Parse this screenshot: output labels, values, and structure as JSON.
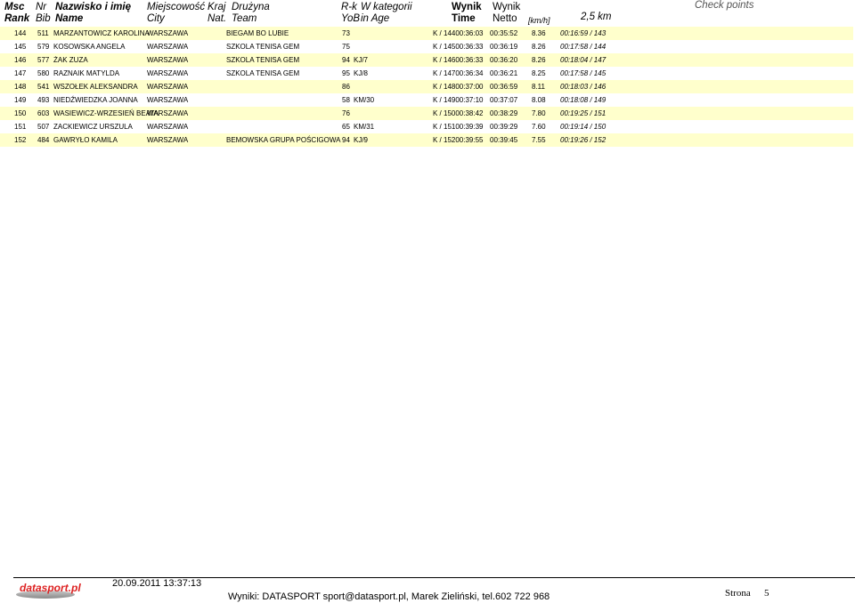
{
  "header": {
    "msc": "Msc",
    "rank": "Rank",
    "nr": "Nr",
    "bib": "Bib",
    "nazwisko": "Nazwisko i imię",
    "name": "Name",
    "miejscowosc": "Miejscowość",
    "city": "City",
    "kraj": "Kraj",
    "nat": "Nat.",
    "druzyna": "Drużyna",
    "team": "Team",
    "rk": "R-k",
    "yob": "YoB",
    "wkategorii": "W kategorii",
    "inage": "in Age",
    "wynik_bold": "Wynik",
    "time": "Time",
    "wynik": "Wynik",
    "netto": "Netto",
    "kmh": "[km/h]",
    "split": "2,5 km",
    "checkpoints": "Check points"
  },
  "rows": [
    {
      "rank": "144",
      "bib": "511",
      "name": "MARZANTOWICZ KAROLINA",
      "city": "WARSZAWA",
      "team": "BIEGAM BO LUBIE",
      "yob": "73",
      "age": "",
      "time": "K / 14400:36:03",
      "netto": "00:35:52",
      "kmh": "8.36",
      "split": "00:16:59 / 143"
    },
    {
      "rank": "145",
      "bib": "579",
      "name": "KOSOWSKA ANGELA",
      "city": "WARSZAWA",
      "team": "SZKOLA TENISA GEM",
      "yob": "75",
      "age": "",
      "time": "K / 14500:36:33",
      "netto": "00:36:19",
      "kmh": "8.26",
      "split": "00:17:58 / 144"
    },
    {
      "rank": "146",
      "bib": "577",
      "name": "ŻAK ZUZA",
      "city": "WARSZAWA",
      "team": "SZKOLA TENISA GEM",
      "yob": "94",
      "age": "KJ/7",
      "time": "K / 14600:36:33",
      "netto": "00:36:20",
      "kmh": "8.26",
      "split": "00:18:04 / 147"
    },
    {
      "rank": "147",
      "bib": "580",
      "name": "RAZNAIK MATYLDA",
      "city": "WARSZAWA",
      "team": "SZKOLA TENISA GEM",
      "yob": "95",
      "age": "KJ/8",
      "time": "K / 14700:36:34",
      "netto": "00:36:21",
      "kmh": "8.25",
      "split": "00:17:58 / 145"
    },
    {
      "rank": "148",
      "bib": "541",
      "name": "WSZOŁEK ALEKSANDRA",
      "city": "WARSZAWA",
      "team": "",
      "yob": "86",
      "age": "",
      "time": "K / 14800:37:00",
      "netto": "00:36:59",
      "kmh": "8.11",
      "split": "00:18:03 / 146"
    },
    {
      "rank": "149",
      "bib": "493",
      "name": "NIEDŹWIEDZKA JOANNA",
      "city": "WARSZAWA",
      "team": "",
      "yob": "58",
      "age": "KM/30",
      "time": "K / 14900:37:10",
      "netto": "00:37:07",
      "kmh": "8.08",
      "split": "00:18:08 / 149"
    },
    {
      "rank": "150",
      "bib": "603",
      "name": "WASIEWICZ-WRZESIEŃ BEATA",
      "city": "WARSZAWA",
      "team": "",
      "yob": "76",
      "age": "",
      "time": "K / 15000:38:42",
      "netto": "00:38:29",
      "kmh": "7.80",
      "split": "00:19:25 / 151"
    },
    {
      "rank": "151",
      "bib": "507",
      "name": "ZACKIEWICZ URSZULA",
      "city": "WARSZAWA",
      "team": "",
      "yob": "65",
      "age": "KM/31",
      "time": "K / 15100:39:39",
      "netto": "00:39:29",
      "kmh": "7.60",
      "split": "00:19:14 / 150"
    },
    {
      "rank": "152",
      "bib": "484",
      "name": "GAWRYŁO KAMILA",
      "city": "WARSZAWA",
      "team": "BEMOWSKA GRUPA POŚCIGOWA",
      "yob": "94",
      "age": "KJ/9",
      "time": "K / 15200:39:55",
      "netto": "00:39:45",
      "kmh": "7.55",
      "split": "00:19:26 / 152"
    }
  ],
  "footer": {
    "logo": "datasport.pl",
    "timestamp": "20.09.2011 13:37:13",
    "contact": "Wyniki: DATASPORT sport@datasport.pl, Marek Zieliński, tel.602 722 968",
    "page_label": "Strona",
    "page_number": "5"
  }
}
